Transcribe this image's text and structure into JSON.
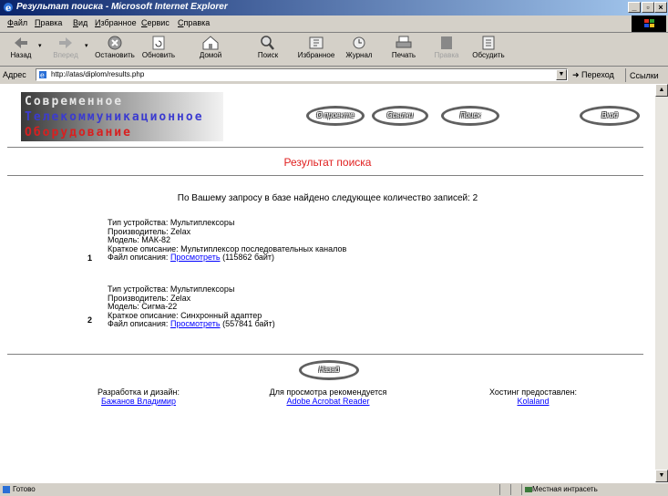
{
  "window": {
    "title": "Результат поиска - Microsoft Internet Explorer"
  },
  "menu": [
    "Файл",
    "Правка",
    "Вид",
    "Избранное",
    "Сервис",
    "Справка"
  ],
  "toolbar": {
    "back": "Назад",
    "forward": "Вперед",
    "stop": "Остановить",
    "refresh": "Обновить",
    "home": "Домой",
    "search": "Поиск",
    "favorites": "Избранное",
    "history": "Журнал",
    "print": "Печать",
    "edit": "Правка",
    "discuss": "Обсудить"
  },
  "address": {
    "label": "Адрес",
    "url": "http://atas/diplom/results.php",
    "go": "Переход",
    "links": "Ссылки"
  },
  "logo": {
    "line1": "Современное",
    "line2": "Телекоммуникационное",
    "line3": "Оборудование"
  },
  "nav": {
    "about": "О проекте",
    "links": "Ссылки",
    "search": "Поиск",
    "login": "Вход"
  },
  "heading": "Результат поиска",
  "summary": "По Вашему запросу в базе найдено следующее количество записей: 2",
  "results": [
    {
      "num": "1",
      "type": "Тип устройства: Мультиплексоры",
      "maker": "Производитель: Zelax",
      "model": "Модель: МАК-82",
      "desc": "Краткое описание: Мультиплексор последовательных каналов",
      "file_label": "Файл описания:",
      "file_link": "Просмотреть",
      "file_size": "(115862 байт)"
    },
    {
      "num": "2",
      "type": "Тип устройства: Мультиплексоры",
      "maker": "Производитель: Zelax",
      "model": "Модель: Сигма-22",
      "desc": "Краткое описание: Синхронный адаптер",
      "file_label": "Файл описания:",
      "file_link": "Просмотреть",
      "file_size": "(557841 байт)"
    }
  ],
  "back_button": "Назад",
  "footer": {
    "dev_label": "Разработка и дизайн:",
    "dev_link": "Бажанов Владимир",
    "view_label": "Для просмотра рекомендуется",
    "view_link": "Adobe Acrobat Reader",
    "host_label": "Хостинг предоставлен:",
    "host_link": "Kolaland"
  },
  "status": {
    "text": "Готово",
    "zone": "Местная интрасеть"
  }
}
